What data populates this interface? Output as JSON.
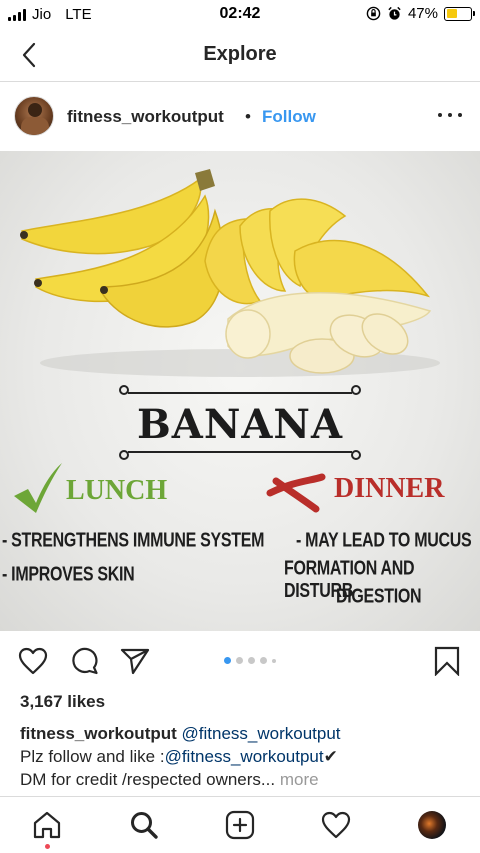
{
  "status_bar": {
    "carrier": "Jio",
    "network": "LTE",
    "time": "02:42",
    "battery_percent": "47%",
    "battery_level": 0.47,
    "battery_color": "#f6c90e"
  },
  "nav": {
    "back_icon": "chevron-left-icon",
    "title": "Explore"
  },
  "post": {
    "username": "fitness_workoutput",
    "separator": "•",
    "follow_label": "Follow",
    "follow_color": "#3897f0",
    "image": {
      "title": "BANANA",
      "lunch_heading": "LUNCH",
      "lunch_points": [
        "- STRENGTHENS IMMUNE SYSTEM",
        "- IMPROVES SKIN"
      ],
      "dinner_heading": "DINNER",
      "dinner_lines": [
        "- MAY LEAD TO MUCUS",
        "FORMATION AND DISTURB",
        "DIGESTION"
      ],
      "lunch_color": "#6da637",
      "dinner_color": "#b92e2a"
    },
    "carousel": {
      "count": 5,
      "active_index": 0
    },
    "likes": "3,167 likes",
    "caption": {
      "user": "fitness_workoutput",
      "mention": "@fitness_workoutput",
      "line2_text": "Plz follow  and like :",
      "line2_mention": "@fitness_workoutput",
      "line2_emoji": "✔",
      "line3_text": "DM for credit /respected owners...",
      "more_label": "more"
    }
  },
  "tabbar": {
    "items": [
      "home-icon",
      "search-icon",
      "add-post-icon",
      "heart-icon",
      "profile-icon"
    ]
  }
}
